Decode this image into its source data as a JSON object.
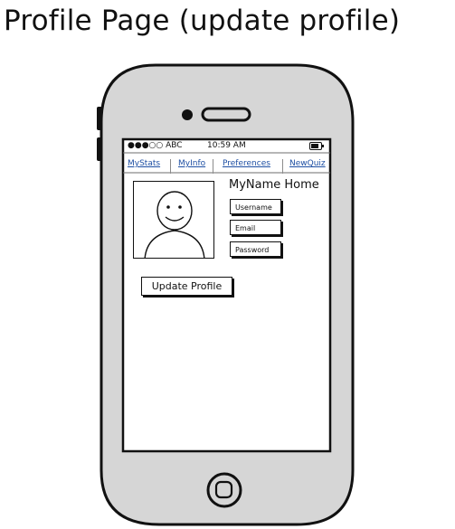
{
  "page": {
    "title": "Profile Page (update profile)"
  },
  "status_bar": {
    "carrier": "●●●○○ ABC",
    "time": "10:59 AM"
  },
  "nav": {
    "items": [
      "MyStats",
      "MyInfo",
      "Preferences",
      "NewQuiz"
    ]
  },
  "profile": {
    "name_heading": "MyName Home",
    "username_placeholder": "Username",
    "email_placeholder": "Email",
    "password_placeholder": "Password",
    "update_button": "Update Profile"
  },
  "icons": {
    "camera": "camera-icon",
    "speaker": "speaker-icon",
    "home": "home-button-icon",
    "battery": "battery-icon",
    "avatar": "smiley-face-icon"
  },
  "colors": {
    "phone_body": "#d6d6d6",
    "screen": "#ffffff",
    "link": "#1e4fa3",
    "outline": "#111111"
  }
}
